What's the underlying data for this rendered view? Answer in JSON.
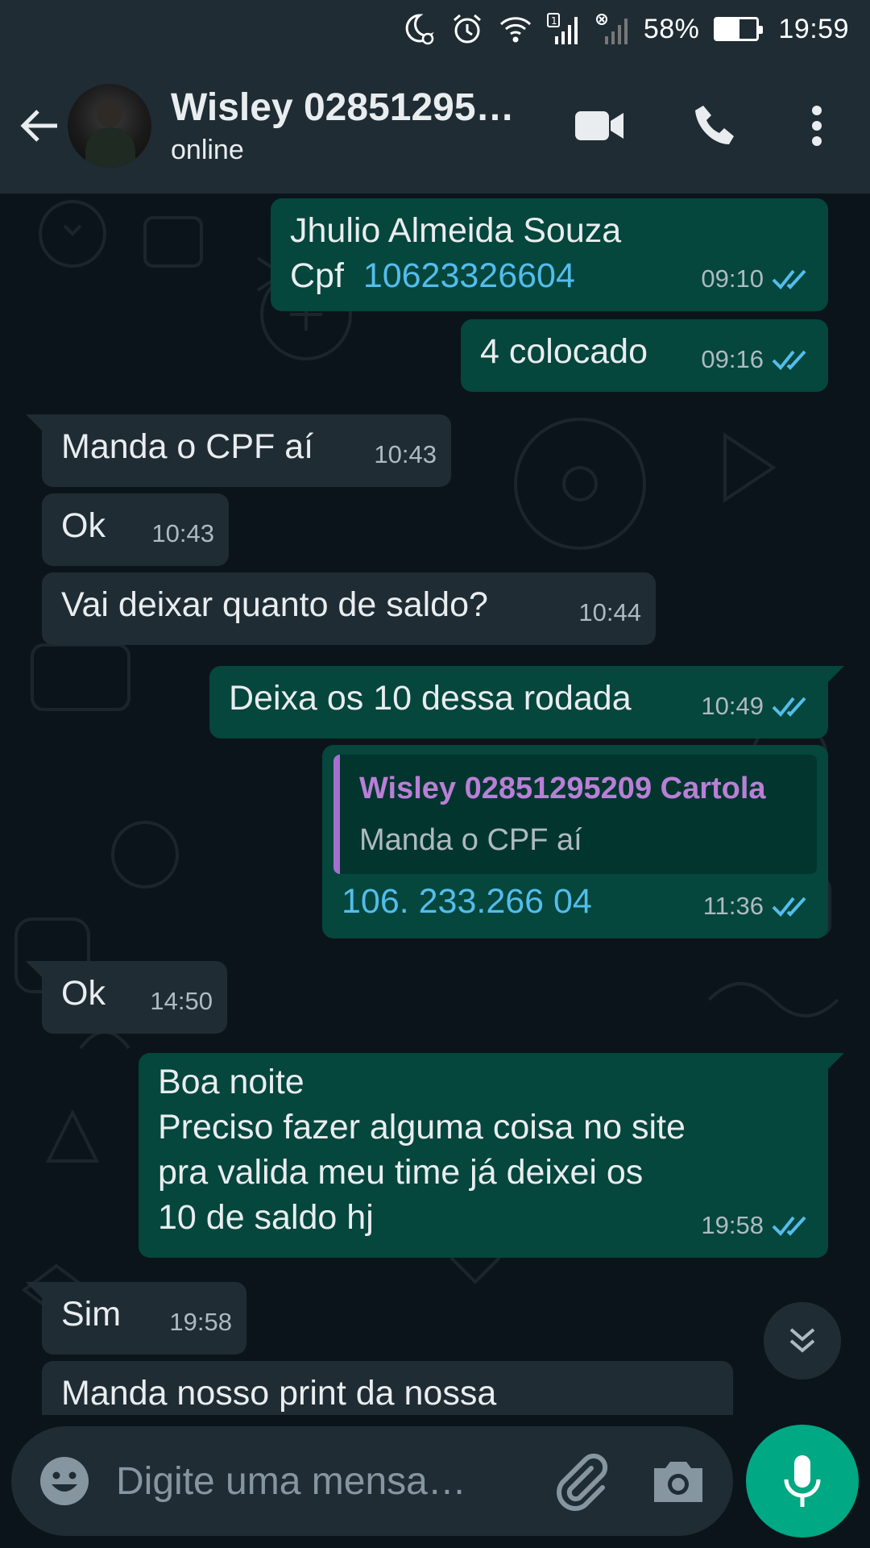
{
  "status_bar": {
    "battery": "58%",
    "battery_level": 0.58,
    "time": "19:59",
    "icons": [
      "moon-alarm-icon",
      "alarm-clock-icon",
      "wifi-icon",
      "signal-sim1-icon",
      "signal-sim2-off-icon",
      "battery-icon"
    ]
  },
  "header": {
    "contact_name": "Wisley 02851295…",
    "status": "online",
    "icons": [
      "back-arrow-icon",
      "video-call-icon",
      "voice-call-icon",
      "more-options-icon"
    ]
  },
  "messages": [
    {
      "id": "m1",
      "dir": "out",
      "text": "Jhulio Almeida Souza",
      "text2_prefix": "Cpf  ",
      "text2_link": "10623326604",
      "time": "09:10",
      "status": "read"
    },
    {
      "id": "m2",
      "dir": "out",
      "text": "4 colocado",
      "time": "09:16",
      "status": "read"
    },
    {
      "id": "m3",
      "dir": "in",
      "text": "Manda o CPF aí",
      "time": "10:43"
    },
    {
      "id": "m4",
      "dir": "in",
      "text": "Ok",
      "time": "10:43"
    },
    {
      "id": "m5",
      "dir": "in",
      "text": "Vai deixar quanto de saldo?",
      "time": "10:44"
    },
    {
      "id": "m6",
      "dir": "out",
      "text": "Deixa os 10 dessa rodada",
      "time": "10:49",
      "status": "read"
    },
    {
      "id": "m7",
      "dir": "out",
      "quote": {
        "author": "Wisley 02851295209 Cartola",
        "text": "Manda o CPF aí"
      },
      "text": "106. 233.266 04",
      "time": "11:36",
      "status": "read"
    },
    {
      "id": "m8",
      "dir": "in",
      "text": "Ok",
      "time": "14:50"
    },
    {
      "id": "m9",
      "dir": "out",
      "text": "Boa noite\nPreciso fazer alguma coisa no site\npra valida meu time já deixei os\n10 de saldo hj",
      "time": "19:58",
      "status": "read"
    },
    {
      "id": "m10",
      "dir": "in",
      "text": "Sim",
      "time": "19:58"
    },
    {
      "id": "m11",
      "dir": "in",
      "text": "Manda nosso print da nossa",
      "time": ""
    }
  ],
  "input": {
    "placeholder": "Digite uma mensa…",
    "value": "",
    "icons": [
      "emoji-icon",
      "attach-icon",
      "camera-icon",
      "mic-icon"
    ]
  },
  "colors": {
    "background": "#0b141a",
    "header": "#1f2c34",
    "incoming_bubble": "#202c33",
    "outgoing_bubble": "#05463d",
    "accent": "#00a884",
    "read_ticks": "#53bdeb",
    "quote_author": "#b97fd6"
  }
}
